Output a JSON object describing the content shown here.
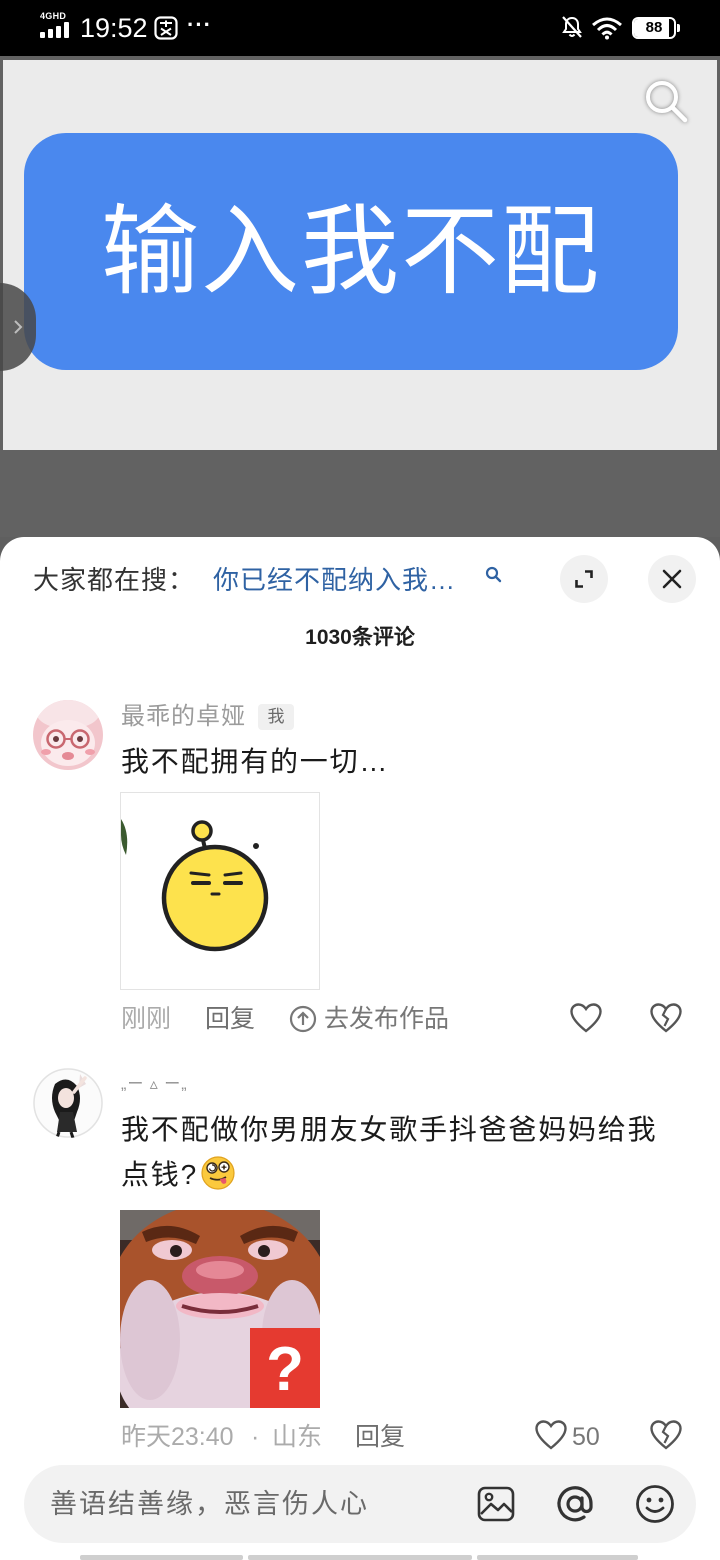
{
  "status_bar": {
    "network": "4GHD",
    "time": "19:52",
    "more": "···",
    "battery": "88",
    "battery_level": 0.88
  },
  "video": {
    "caption_text": "输入我不配"
  },
  "search_hint": {
    "prefix": "大家都在搜：",
    "query": "你已经不配纳入我…"
  },
  "comments_header": {
    "count_label": "1030条评论"
  },
  "comments": [
    {
      "author": "最乖的卓娅",
      "badge": "我",
      "text": "我不配拥有的一切…",
      "sticker": "yellow-blob-emoji",
      "time": "刚刚",
      "reply_label": "回复",
      "publish_label": "去发布作品"
    },
    {
      "author": "„ー ▵ ー„",
      "text": "我不配做你男朋友女歌手抖爸爸妈妈给我点钱?",
      "emoji": "silly-face-emoji",
      "sticker": "bear-face-question",
      "sticker_mark": "?",
      "time": "昨天23:40",
      "separator": "·",
      "location": "山东",
      "reply_label": "回复",
      "likes": "50"
    }
  ],
  "input": {
    "placeholder": "善语结善缘，恶言伤人心"
  },
  "icons": {
    "video_search": "search-icon",
    "expand": "expand-icon",
    "close": "close-icon",
    "like": "heart-icon",
    "dislike": "broken-heart-icon",
    "publish": "upload-circle-icon",
    "image": "image-icon",
    "mention": "at-icon",
    "emoji": "smile-icon"
  },
  "colors": {
    "status_bar_bg": "#000000",
    "video_card_blue": "#4a88ee",
    "search_query_blue": "#2f62a3",
    "panel_bg": "#ffffff",
    "muted_text": "#9b9b9b",
    "input_bg": "#f2f2f2",
    "sticker_red": "#e53a30"
  }
}
